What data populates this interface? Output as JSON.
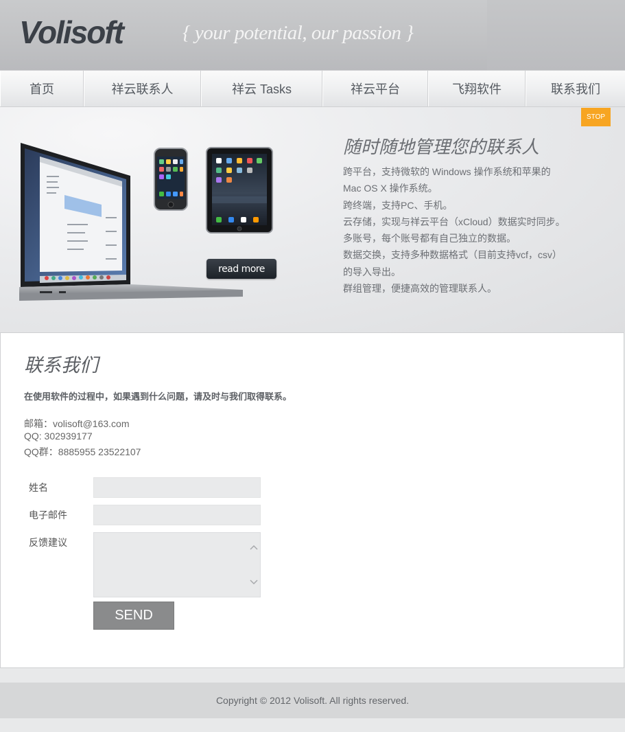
{
  "header": {
    "logo": "Volisoft",
    "tagline": "{ your potential, our passion }"
  },
  "nav": {
    "items": [
      {
        "label": "首页"
      },
      {
        "label": "祥云联系人"
      },
      {
        "label": "祥云 Tasks"
      },
      {
        "label": "祥云平台"
      },
      {
        "label": "飞翔软件"
      },
      {
        "label": "联系我们"
      }
    ]
  },
  "banner": {
    "stop_label": "STOP",
    "title": "随时随地管理您的联系人",
    "lines": [
      "跨平台，支持微软的 Windows 操作系统和苹果的",
      "Mac OS X 操作系统。",
      "跨终端，支持PC、手机。",
      "云存储，实现与祥云平台（xCloud）数据实时同步。",
      "多账号，每个账号都有自己独立的数据。",
      "数据交换，支持多种数据格式（目前支持vcf，csv）",
      "的导入导出。",
      "群组管理，便捷高效的管理联系人。"
    ],
    "read_more_label": "read more",
    "colors": {
      "stop": "#f7a522",
      "read_more": "#1d2228"
    }
  },
  "contact": {
    "title": "联系我们",
    "intro": "在使用软件的过程中，如果遇到什么问题，请及时与我们取得联系。",
    "email_line": "邮箱：volisoft@163.com",
    "qq_line": "QQ: 302939177",
    "qq_group_line": "QQ群：8885955 23522107"
  },
  "form": {
    "name_label": "姓名",
    "name_value": "",
    "email_label": "电子邮件",
    "email_value": "",
    "feedback_label": "反馈建议",
    "feedback_value": "",
    "send_label": "SEND"
  },
  "footer": {
    "copyright": "Copyright © 2012 Volisoft. All rights reserved."
  }
}
